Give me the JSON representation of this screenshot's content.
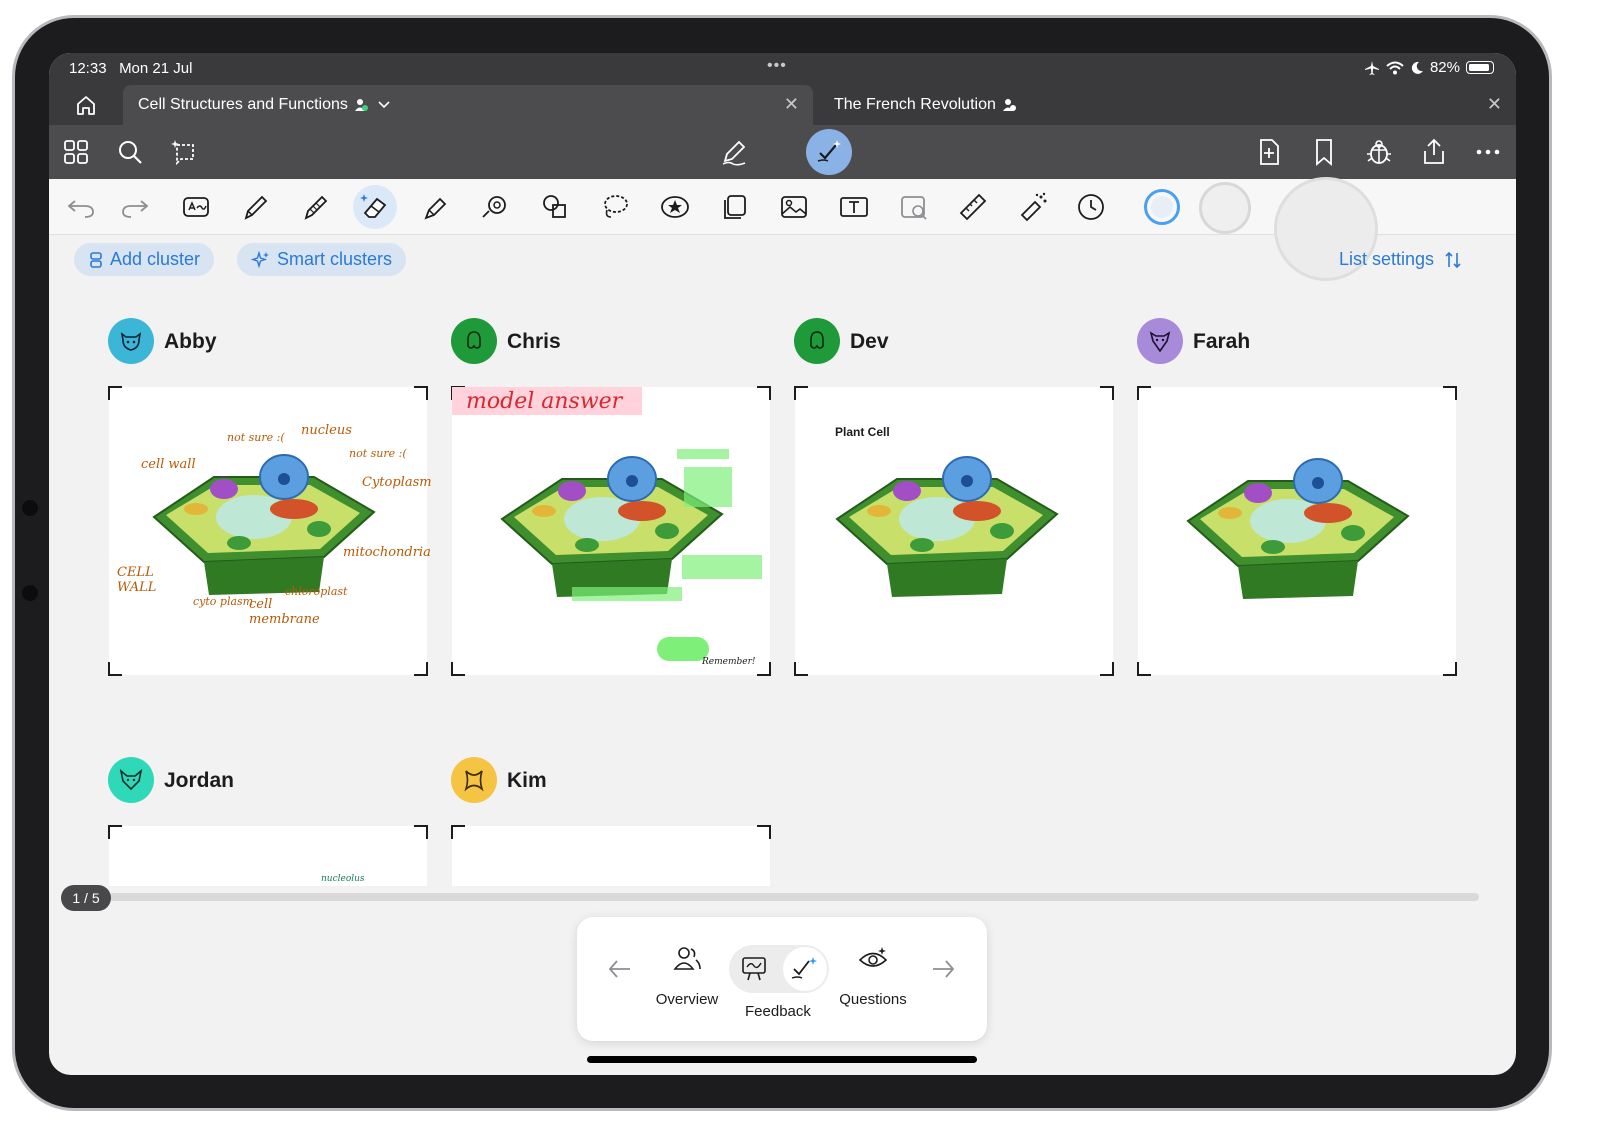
{
  "status": {
    "time": "12:33",
    "date": "Mon 21 Jul",
    "battery": "82%"
  },
  "tabs": [
    {
      "label": "Cell Structures and Functions",
      "active": true
    },
    {
      "label": "The French Revolution",
      "active": false
    }
  ],
  "actions": {
    "add_cluster": "Add cluster",
    "smart_clusters": "Smart clusters",
    "list_settings": "List settings"
  },
  "students": [
    {
      "name": "Abby",
      "color": "#3bb6d6"
    },
    {
      "name": "Chris",
      "color": "#1f9a3a"
    },
    {
      "name": "Dev",
      "color": "#1f9a3a"
    },
    {
      "name": "Farah",
      "color": "#a78ad8"
    },
    {
      "name": "Jordan",
      "color": "#2ed8b9"
    },
    {
      "name": "Kim",
      "color": "#f5c443"
    }
  ],
  "pages": {
    "abby": [
      "nucleus",
      "not sure :(",
      "cell wall",
      "Cytoplasm",
      "mitochondria",
      "CELL WALL",
      "cyto plasm",
      "cell membrane",
      "chloroplast"
    ],
    "chris": {
      "banner": "model answer",
      "note": "Remember!"
    },
    "dev": {
      "title": "Plant Cell"
    },
    "jordan": {
      "note": "nucleolus"
    }
  },
  "pager": {
    "current": "1 / 5"
  },
  "bottom_nav": {
    "overview": "Overview",
    "feedback": "Feedback",
    "questions": "Questions"
  }
}
